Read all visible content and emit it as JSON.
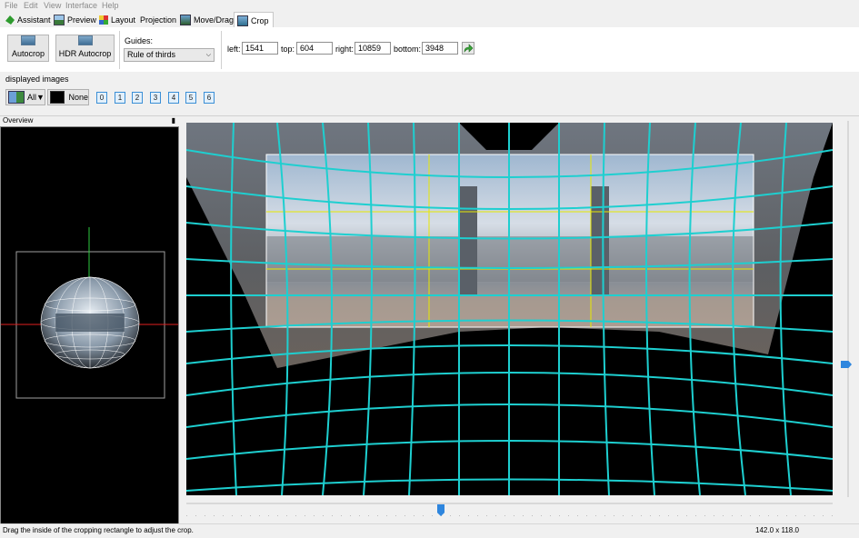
{
  "menu": [
    "File",
    "Edit",
    "View",
    "Interface",
    "Help"
  ],
  "tabs": [
    {
      "label": "Assistant",
      "icon": "assistant-icon"
    },
    {
      "label": "Preview",
      "icon": "preview-icon"
    },
    {
      "label": "Layout",
      "icon": "layout-icon"
    },
    {
      "label": "Projection",
      "icon": ""
    },
    {
      "label": "Move/Drag",
      "icon": "move-drag-icon"
    },
    {
      "label": "Crop",
      "icon": "crop-icon",
      "active": true
    }
  ],
  "toolbar": {
    "autocrop": "Autocrop",
    "hdr_autocrop": "HDR Autocrop",
    "guides_label": "Guides:",
    "guides_value": "Rule of thirds",
    "left_label": "left:",
    "left_value": "1541",
    "top_label": "top:",
    "top_value": "604",
    "right_label": "right:",
    "right_value": "10859",
    "bottom_label": "bottom:",
    "bottom_value": "3948"
  },
  "displayed_images": {
    "title": "displayed images",
    "all_label": "All▼",
    "none_label": "None",
    "numbers": [
      "0",
      "1",
      "2",
      "3",
      "4",
      "5",
      "6"
    ]
  },
  "overview": {
    "title": "Overview"
  },
  "status": {
    "message": "Drag the inside of the cropping rectangle to adjust the crop.",
    "fov": "142.0 x 118.0"
  },
  "colors": {
    "grid": "#1ecfd0",
    "grid_dark": "#0f8f8f",
    "guide": "#e8e800",
    "accent": "#2e86de"
  }
}
